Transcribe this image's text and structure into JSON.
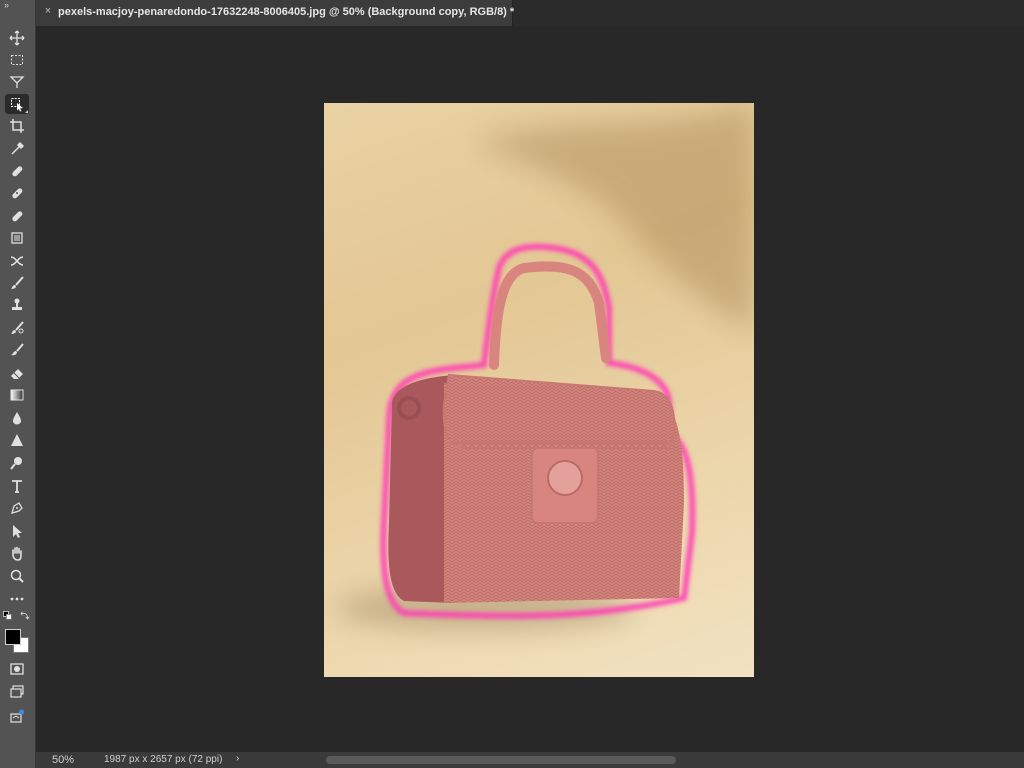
{
  "document": {
    "tab_title": "pexels-macjoy-penaredondo-17632248-8006405.jpg @ 50% (Background copy, RGB/8) *",
    "close_glyph": "×"
  },
  "status": {
    "zoom": "50%",
    "doc_info": "1987 px x 2657 px (72 ppi)",
    "chevron": "›"
  },
  "toolbar": {
    "collapse_glyph": "››",
    "tools": [
      "move-tool-icon",
      "marquee-tool-icon",
      "lasso-tool-icon",
      "object-selection-tool-icon",
      "crop-tool-icon",
      "eyedropper-tool-icon",
      "spot-healing-tool-icon",
      "healing-brush-icon",
      "patch-tool-icon",
      "content-aware-move-icon",
      "brush-tool-icon",
      "clone-stamp-icon",
      "history-brush-icon",
      "art-history-brush-icon",
      "eraser-tool-icon",
      "gradient-tool-icon",
      "blur-tool-icon",
      "sharpen-tool-icon",
      "dodge-tool-icon",
      "type-tool-icon",
      "pen-tool-icon",
      "path-selection-icon",
      "hand-tool-icon",
      "zoom-tool-icon",
      "more-tools-icon"
    ],
    "active_tool": "object-selection-tool-icon",
    "foreground_color": "#000000",
    "background_color": "#ffffff"
  },
  "colors": {
    "mask_overlay": "#ff3fb4",
    "bag_tint": "#d9857f",
    "backdrop": "#e6cd9c"
  }
}
